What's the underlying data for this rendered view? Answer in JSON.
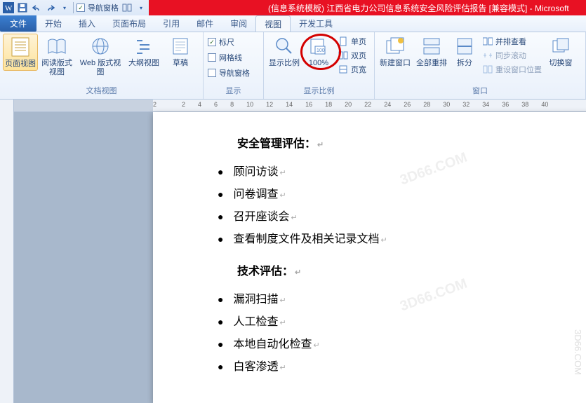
{
  "titlebar": {
    "title_text": "(信息系统模板)   江西省电力公司信息系统安全风险评估报告 [兼容模式] - Microsoft",
    "nav_pane": "导航窗格"
  },
  "menu": {
    "file": "文件",
    "tabs": [
      "开始",
      "插入",
      "页面布局",
      "引用",
      "邮件",
      "审阅",
      "视图",
      "开发工具"
    ]
  },
  "ribbon": {
    "group_views": {
      "label": "文档视图",
      "page_view": "页面视图",
      "reading": "阅读版式\n视图",
      "web": "Web 版式视图",
      "outline": "大纲视图",
      "draft": "草稿"
    },
    "group_show": {
      "label": "显示",
      "ruler": "标尺",
      "gridlines": "网格线",
      "nav_pane": "导航窗格"
    },
    "group_zoom": {
      "label": "显示比例",
      "zoom": "显示比例",
      "hundred": "100%",
      "one_page": "单页",
      "two_page": "双页",
      "page_width": "页宽"
    },
    "group_window": {
      "label": "窗口",
      "new_window": "新建窗口",
      "arrange_all": "全部重排",
      "split": "拆分",
      "side_by_side": "并排查看",
      "sync_scroll": "同步滚动",
      "reset_pos": "重设窗口位置",
      "switch": "切换窗"
    }
  },
  "ruler_marks": [
    "2",
    "",
    "2",
    "4",
    "6",
    "8",
    "10",
    "12",
    "14",
    "16",
    "18",
    "20",
    "22",
    "24",
    "26",
    "28",
    "30",
    "32",
    "34",
    "36",
    "38",
    "40"
  ],
  "doc": {
    "h1": "安全管理评估：",
    "list1": [
      "顾问访谈",
      "问卷调查",
      "召开座谈会",
      "查看制度文件及相关记录文档"
    ],
    "h2": "技术评估：",
    "list2": [
      "漏洞扫描",
      "人工检查",
      "本地自动化检查",
      "白客渗透"
    ]
  },
  "wm_side": "3D66.COM"
}
